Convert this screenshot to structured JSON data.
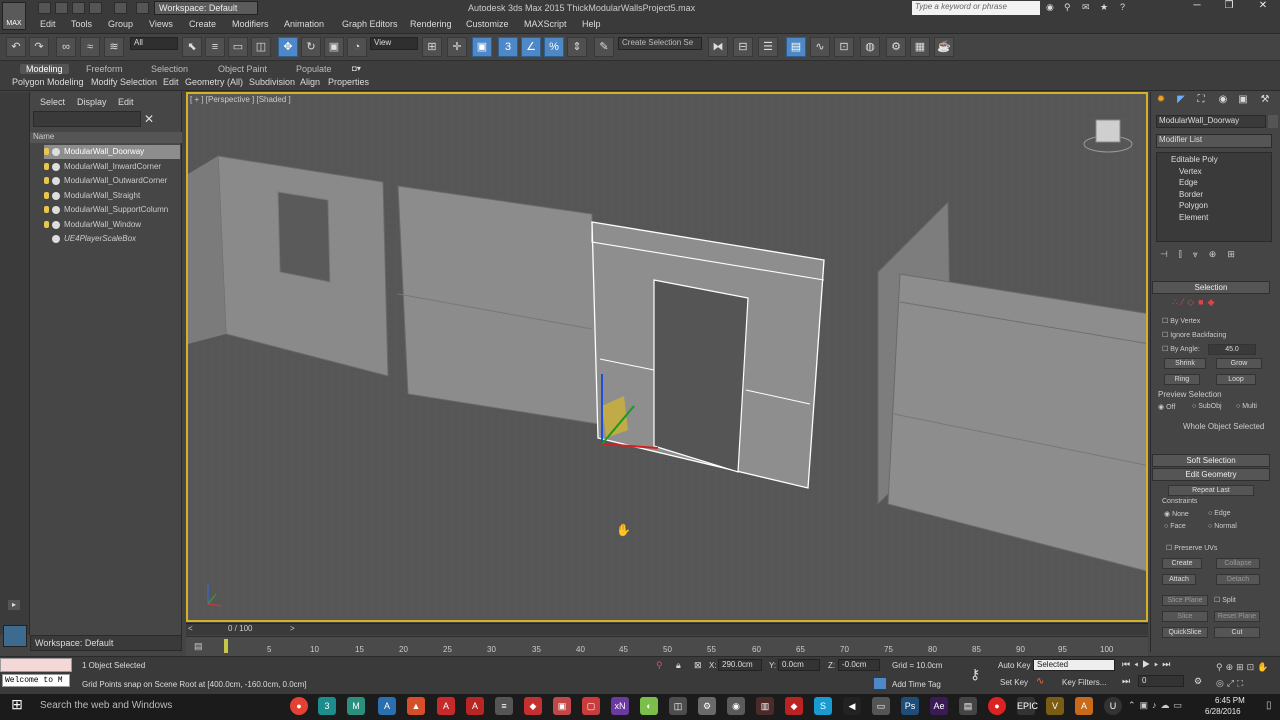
{
  "titlebar": {
    "app_title": "Autodesk 3ds Max 2015     ThickModularWallsProject5.max",
    "workspace_label": "Workspace: Default",
    "search_placeholder": "Type a keyword or phrase",
    "app_icon_label": "MAX"
  },
  "menu": [
    "Edit",
    "Tools",
    "Group",
    "Views",
    "Create",
    "Modifiers",
    "Animation",
    "Graph Editors",
    "Rendering",
    "Customize",
    "MAXScript",
    "Help"
  ],
  "toolbar": {
    "selection_filter": "All",
    "ref_coord": "View",
    "named_selection": "Create Selection Se"
  },
  "ribbon": {
    "tabs": [
      "Modeling",
      "Freeform",
      "Selection",
      "Object Paint",
      "Populate"
    ],
    "items": [
      "Polygon Modeling",
      "Modify Selection",
      "Edit",
      "Geometry (All)",
      "Subdivision",
      "Align",
      "Properties"
    ]
  },
  "scene_explorer": {
    "tabs": [
      "Select",
      "Display",
      "Edit"
    ],
    "column_header": "Name",
    "objects": [
      "ModularWall_Doorway",
      "ModularWall_InwardCorner",
      "ModularWall_OutwardCorner",
      "ModularWall_Straight",
      "ModularWall_SupportColumn",
      "ModularWall_Window",
      "UE4PlayerScaleBox"
    ],
    "workspace": "Workspace: Default"
  },
  "viewport": {
    "label": "[ + ] [Perspective ] [Shaded ]"
  },
  "command_panel": {
    "object_name": "ModularWall_Doorway",
    "modifier_list": "Modifier List",
    "stack": [
      "Editable Poly",
      "Vertex",
      "Edge",
      "Border",
      "Polygon",
      "Element"
    ],
    "selection_title": "Selection",
    "by_vertex": "By Vertex",
    "ignore_backfacing": "Ignore Backfacing",
    "by_angle": "By Angle:",
    "by_angle_value": "45.0",
    "shrink": "Shrink",
    "grow": "Grow",
    "ring": "Ring",
    "loop": "Loop",
    "preview_selection": "Preview Selection",
    "preview_options": [
      "Off",
      "SubObj",
      "Multi"
    ],
    "whole_object": "Whole Object Selected",
    "soft_selection": "Soft Selection",
    "edit_geometry": "Edit Geometry",
    "repeat_last": "Repeat Last",
    "constraints": "Constraints",
    "constraint_options": [
      "None",
      "Edge",
      "Face",
      "Normal"
    ],
    "preserve_uvs": "Preserve UVs",
    "create": "Create",
    "collapse": "Collapse",
    "attach": "Attach",
    "detach": "Detach",
    "slice_plane": "Slice Plane",
    "split": "Split",
    "slice": "Slice",
    "reset_plane": "Reset Plane",
    "quickslice": "QuickSlice",
    "cut": "Cut"
  },
  "timeline": {
    "frame_display": "0 / 100",
    "ticks": [
      "5",
      "10",
      "15",
      "20",
      "25",
      "30",
      "35",
      "40",
      "45",
      "50",
      "55",
      "60",
      "65",
      "70",
      "75",
      "80",
      "85",
      "90",
      "95",
      "100"
    ]
  },
  "status": {
    "selected": "1 Object Selected",
    "prompt": "Grid Points snap on Scene Root at [400.0cm, -160.0cm, 0.0cm]",
    "welcome": "Welcome to M",
    "x_label": "X:",
    "x": "290.0cm",
    "y_label": "Y:",
    "y": "0.0cm",
    "z_label": "Z:",
    "z": "-0.0cm",
    "grid": "Grid = 10.0cm",
    "add_time_tag": "Add Time Tag",
    "auto_key": "Auto Key",
    "set_key": "Set Key",
    "key_mode": "Selected",
    "key_filters": "Key Filters...",
    "frame": "0"
  },
  "taskbar": {
    "search": "Search the web and Windows",
    "time": "6:45 PM",
    "date": "6/28/2016"
  },
  "colors": {
    "viewport_border": "#d3b227",
    "active_blue": "#4e88c7"
  }
}
